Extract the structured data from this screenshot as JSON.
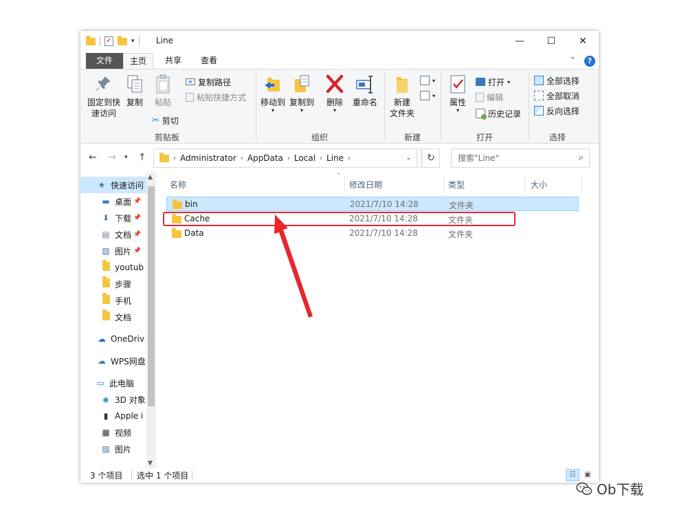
{
  "window": {
    "title": "Line",
    "minimize": "—",
    "maximize": "☐",
    "close": "✕"
  },
  "menu_tabs": {
    "file": "文件",
    "home": "主页",
    "share": "共享",
    "view": "查看",
    "help": "?"
  },
  "ribbon": {
    "clipboard": {
      "label": "剪贴板",
      "pin_line1": "固定到快",
      "pin_line2": "速访问",
      "copy": "复制",
      "paste": "粘贴",
      "copy_path": "复制路径",
      "paste_shortcut": "粘贴快捷方式",
      "cut": "剪切"
    },
    "organize": {
      "label": "组织",
      "move_to": "移动到",
      "copy_to": "复制到",
      "delete": "删除",
      "rename": "重命名"
    },
    "new": {
      "label": "新建",
      "new_folder_line1": "新建",
      "new_folder_line2": "文件夹"
    },
    "open": {
      "label": "打开",
      "properties": "属性",
      "open": "打开",
      "edit": "编辑",
      "history": "历史记录"
    },
    "select": {
      "label": "选择",
      "select_all": "全部选择",
      "select_none": "全部取消",
      "invert": "反向选择"
    }
  },
  "address": {
    "crumbs": [
      "Administrator",
      "AppData",
      "Local",
      "Line"
    ],
    "search_placeholder": "搜索\"Line\""
  },
  "nav_pane": {
    "items": [
      {
        "label": "快速访问",
        "icon": "star-icon",
        "pinned": false
      },
      {
        "label": "桌面",
        "icon": "desktop-icon",
        "pinned": true
      },
      {
        "label": "下载",
        "icon": "download-icon",
        "pinned": true
      },
      {
        "label": "文档",
        "icon": "document-icon",
        "pinned": true
      },
      {
        "label": "图片",
        "icon": "picture-icon",
        "pinned": true
      },
      {
        "label": "youtub",
        "icon": "folder-icon",
        "pinned": false
      },
      {
        "label": "步骤",
        "icon": "folder-icon",
        "pinned": false
      },
      {
        "label": "手机",
        "icon": "folder-icon",
        "pinned": false
      },
      {
        "label": "文档",
        "icon": "folder-icon",
        "pinned": false
      },
      {
        "label": "OneDriv",
        "icon": "cloud-icon",
        "pinned": false
      },
      {
        "label": "WPS网盘",
        "icon": "wps-cloud-icon",
        "pinned": false
      },
      {
        "label": "此电脑",
        "icon": "computer-icon",
        "pinned": false
      },
      {
        "label": "3D 对象",
        "icon": "cube-icon",
        "pinned": false
      },
      {
        "label": "Apple i",
        "icon": "phone-icon",
        "pinned": false
      },
      {
        "label": "视频",
        "icon": "video-icon",
        "pinned": false
      },
      {
        "label": "图片",
        "icon": "picture-icon",
        "pinned": false
      }
    ]
  },
  "file_list": {
    "columns": {
      "name": "名称",
      "modified": "修改日期",
      "type": "类型",
      "size": "大小"
    },
    "rows": [
      {
        "name": "bin",
        "modified": "2021/7/10 14:28",
        "type": "文件夹",
        "selected": true
      },
      {
        "name": "Cache",
        "modified": "2021/7/10 14:28",
        "type": "文件夹",
        "selected": false
      },
      {
        "name": "Data",
        "modified": "2021/7/10 14:28",
        "type": "文件夹",
        "selected": false
      }
    ]
  },
  "status": {
    "item_count": "3 个项目",
    "selected_count": "选中 1 个项目"
  },
  "watermark": {
    "text": "Ob下载"
  },
  "colors": {
    "annotation_red": "#e8262d",
    "selection_blue": "#cce8ff",
    "folder_yellow": "#f5c542"
  }
}
